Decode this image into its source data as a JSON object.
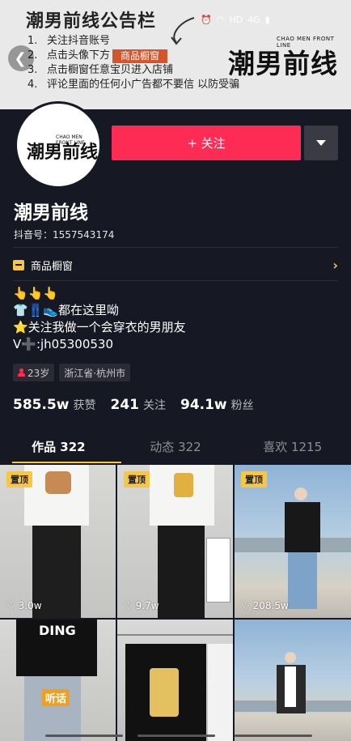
{
  "banner": {
    "title": "潮男前线公告栏",
    "items": [
      {
        "num": "1.",
        "text": "关注抖音账号"
      },
      {
        "num": "2.",
        "text": "点击头像下方",
        "tag": "商品橱窗"
      },
      {
        "num": "3.",
        "text": "点击橱窗任意宝贝进入店铺"
      },
      {
        "num": "4.",
        "text": "评论里面的任何小广告都不要信  以防受骗"
      }
    ],
    "logo_small": "CHAO MEN FRONT LINE",
    "logo_big": "潮男前线"
  },
  "status_bar": {
    "network": "HD",
    "signal": "4G"
  },
  "profile": {
    "avatar_small": "CHAO MEN FRONT LINE",
    "avatar_big": "潮男前线",
    "follow_label": "+ 关注",
    "name": "潮男前线",
    "douyin_id": "抖音号：1557543174",
    "shop_label": "商品橱窗",
    "bio": [
      "👆👆👆",
      "👕👖👟都在这里呦",
      "⭐关注我做一个会穿衣的男朋友",
      "V➕:jh05300530"
    ],
    "tags": [
      {
        "text": "23岁",
        "icon": "person-icon"
      },
      {
        "text": "浙江省·杭州市"
      }
    ],
    "stats": [
      {
        "value": "585.5w",
        "label": "获赞"
      },
      {
        "value": "241",
        "label": "关注"
      },
      {
        "value": "94.1w",
        "label": "粉丝"
      }
    ]
  },
  "tabs": [
    {
      "label": "作品 322",
      "active": true
    },
    {
      "label": "动态 322",
      "active": false
    },
    {
      "label": "喜欢 1215",
      "active": false
    }
  ],
  "videos": [
    {
      "pinned": "置顶",
      "likes": "3.0w"
    },
    {
      "pinned": "置顶",
      "likes": "9.7w"
    },
    {
      "pinned": "置顶",
      "likes": "208.5w"
    },
    {
      "shirt_text": "DING",
      "caption": "听话"
    },
    {},
    {}
  ],
  "colors": {
    "accent": "#fe2c55",
    "gold": "#f7c646",
    "background": "#161823"
  }
}
